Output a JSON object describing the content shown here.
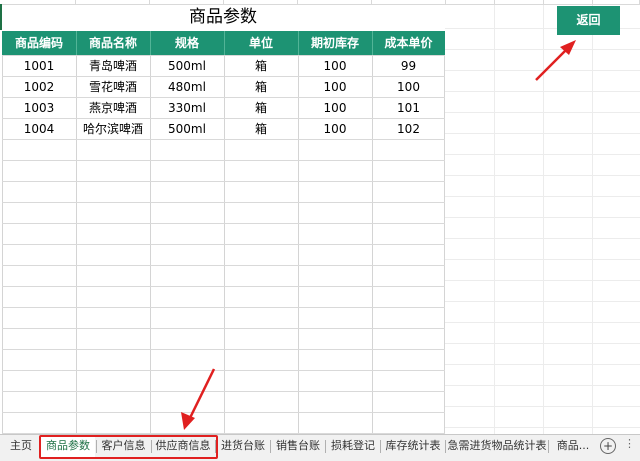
{
  "sheet": {
    "title": "商品参数",
    "columns": [
      "商品编码",
      "商品名称",
      "规格",
      "单位",
      "期初库存",
      "成本单价"
    ],
    "rows": [
      [
        "1001",
        "青岛啤酒",
        "500ml",
        "箱",
        "100",
        "99"
      ],
      [
        "1002",
        "雪花啤酒",
        "480ml",
        "箱",
        "100",
        "100"
      ],
      [
        "1003",
        "燕京啤酒",
        "330ml",
        "箱",
        "100",
        "101"
      ],
      [
        "1004",
        "哈尔滨啤酒",
        "500ml",
        "箱",
        "100",
        "102"
      ]
    ]
  },
  "return_button": {
    "label": "返回"
  },
  "tabs": [
    {
      "label": "主页"
    },
    {
      "label": "商品参数"
    },
    {
      "label": "客户信息"
    },
    {
      "label": "供应商信息"
    },
    {
      "label": "进货台账"
    },
    {
      "label": "销售台账"
    },
    {
      "label": "损耗登记"
    },
    {
      "label": "库存统计表"
    },
    {
      "label": "急需进货物品统计表"
    },
    {
      "label": "商品..."
    }
  ],
  "annotation_color": "#e02020",
  "accent_color": "#1d9373",
  "icons": {
    "add_sheet": "plus-circle-icon",
    "more": "more-dots-icon"
  }
}
